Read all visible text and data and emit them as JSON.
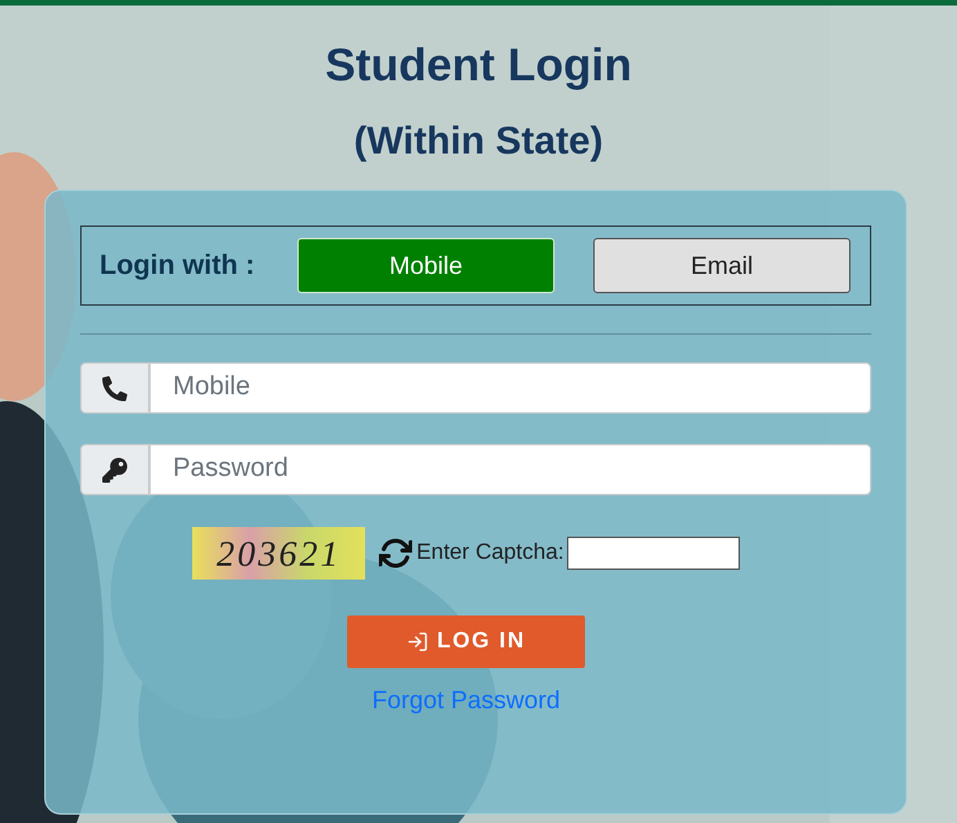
{
  "title": "Student Login",
  "subtitle": "(Within State)",
  "login_with": {
    "label": "Login with :",
    "options": [
      {
        "label": "Mobile",
        "selected": true
      },
      {
        "label": "Email",
        "selected": false
      }
    ]
  },
  "fields": [
    {
      "kind": "phone",
      "placeholder": "Mobile"
    },
    {
      "kind": "key",
      "placeholder": "Password"
    }
  ],
  "captcha": {
    "code": "203621",
    "label": "Enter Captcha:"
  },
  "login_button": "LOG IN",
  "forgot_link": "Forgot Password"
}
